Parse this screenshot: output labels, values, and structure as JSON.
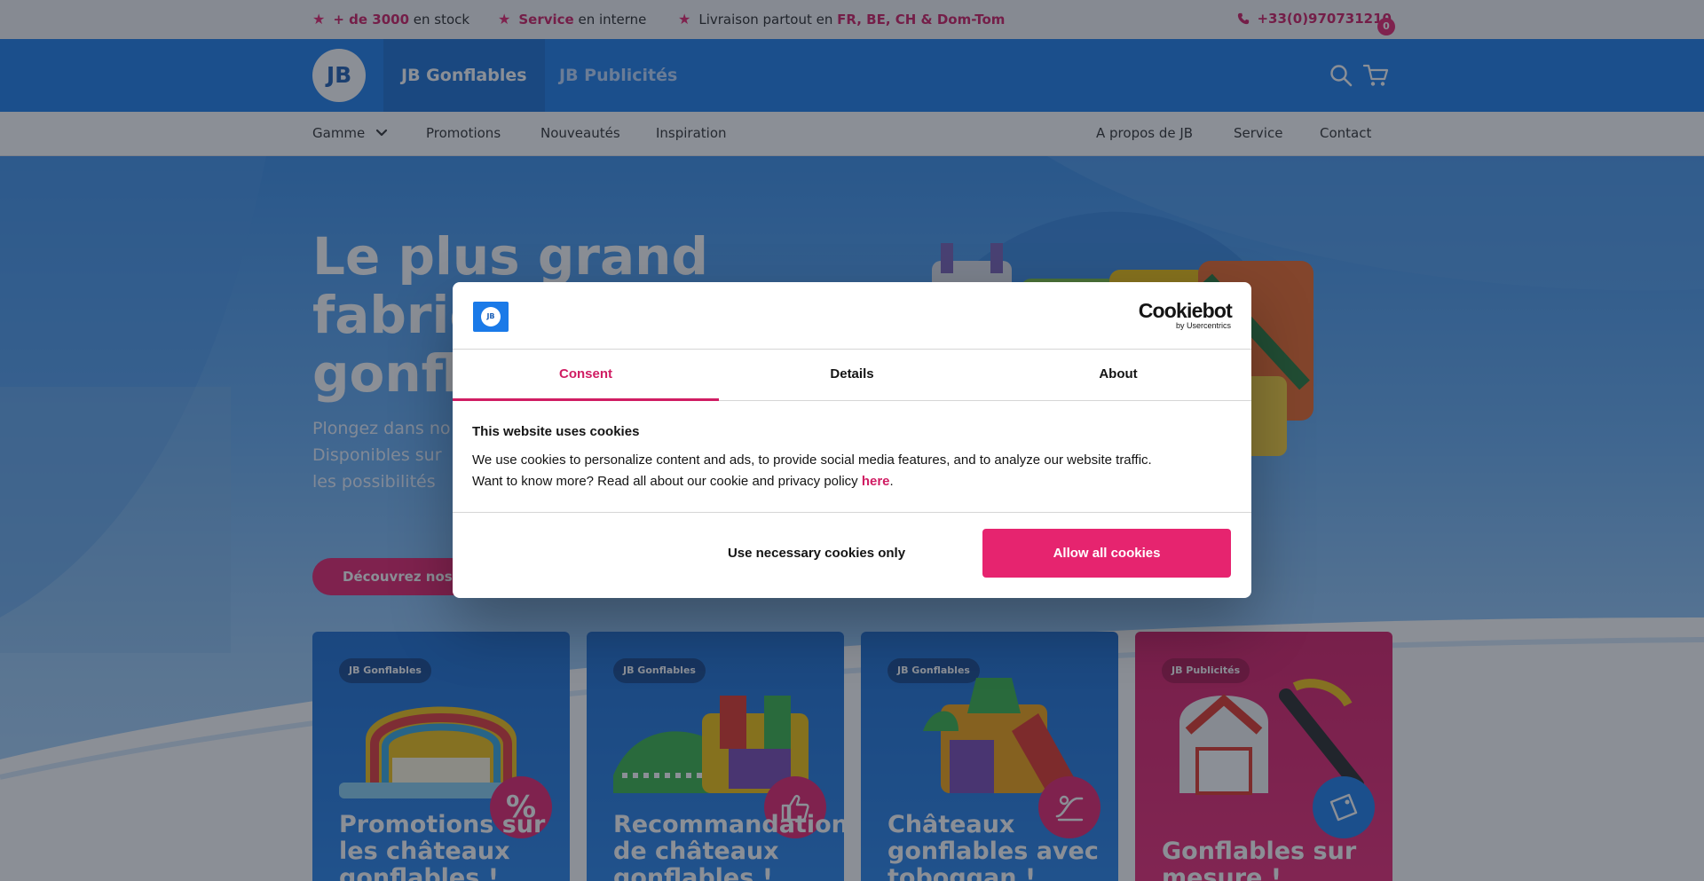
{
  "colors": {
    "brand_blue": "#1f7fea",
    "brand_pink": "#e6246f",
    "accent_text": "#d01d63"
  },
  "topbar": {
    "usps": [
      {
        "bold": "+ de 3000",
        "text": " en stock",
        "icon": "star-icon"
      },
      {
        "bold": "Service",
        "text": " en interne",
        "icon": "star-icon"
      },
      {
        "text": "Livraison partout en ",
        "bold": "FR, BE, CH & Dom-Tom",
        "icon": "star-icon"
      }
    ],
    "phone": "+33(0)970731210",
    "phone_icon": "phone-icon"
  },
  "header": {
    "logo_text": "JB",
    "brand_tabs": [
      "JB Gonflables",
      "JB Publicités"
    ],
    "cart_count": "0",
    "icons": [
      "search-icon",
      "cart-icon"
    ]
  },
  "subnav": {
    "left": [
      "Gamme",
      "Promotions",
      "Nouveautés",
      "Inspiration"
    ],
    "right": [
      "A propos de JB",
      "Service",
      "Contact"
    ]
  },
  "hero": {
    "title_lines": [
      "Le plus grand",
      "fabric",
      "gonfla"
    ],
    "text_lines": [
      "Plongez dans no",
      "Disponibles sur",
      "les possibilités"
    ],
    "cta": "Découvrez nos"
  },
  "cards": [
    {
      "chip": "JB Gonflables",
      "title_lines": [
        "Promotions sur",
        "les châteaux",
        "gonflables !"
      ],
      "badge": "%",
      "badge_icon": "percent-icon"
    },
    {
      "chip": "JB Gonflables",
      "title_lines": [
        "Recommandations",
        "de châteaux",
        "gonflables !"
      ],
      "badge_icon": "thumbs-up-icon"
    },
    {
      "chip": "JB Gonflables",
      "title_lines": [
        "Châteaux",
        "gonflables avec",
        "toboggan !"
      ],
      "badge_icon": "slide-icon"
    },
    {
      "chip": "JB Publicités",
      "title_lines": [
        "Gonflables sur",
        "mesure !"
      ],
      "badge_icon": "custom-tag-icon"
    }
  ],
  "cookie_dialog": {
    "brand_big": "Cookiebot",
    "brand_small": "by Usercentrics",
    "logo_text": "JB",
    "tabs": [
      "Consent",
      "Details",
      "About"
    ],
    "active_tab": "Consent",
    "heading": "This website uses cookies",
    "body_line1": "We use cookies to personalize content and ads, to provide social media features, and to analyze our website traffic.",
    "body_line2_prefix": "Want to know more? Read all about our cookie and privacy policy ",
    "link_text": "here",
    "body_line2_suffix": ".",
    "btn_necessary": "Use necessary cookies only",
    "btn_allow": "Allow all cookies"
  }
}
